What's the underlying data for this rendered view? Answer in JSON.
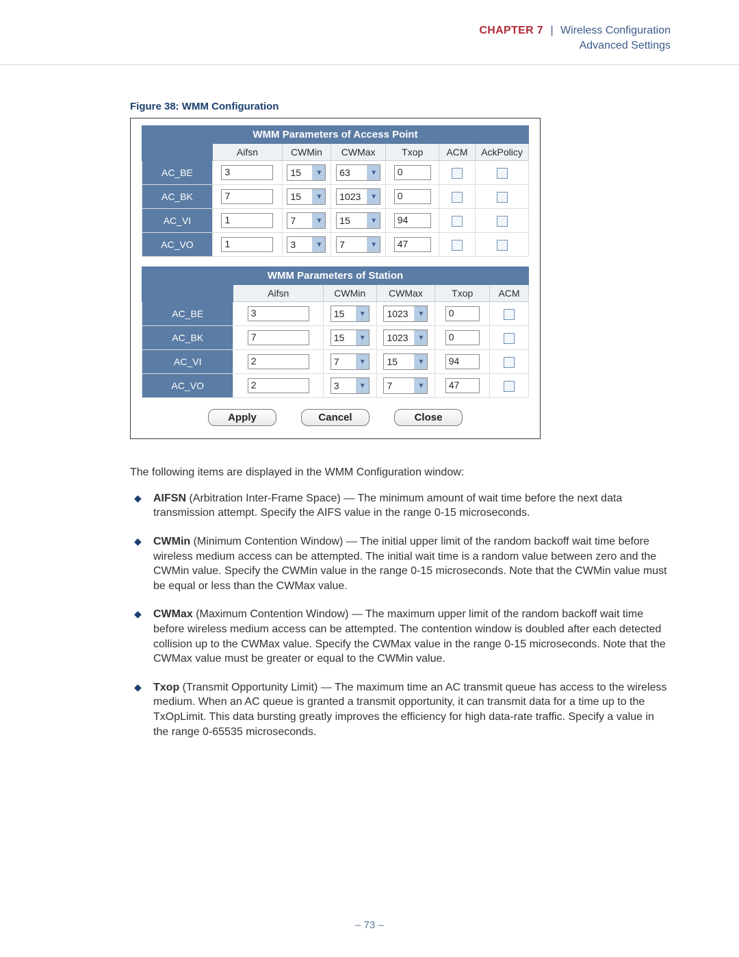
{
  "header": {
    "chapter_label": "CHAPTER 7",
    "pipe": "|",
    "title": "Wireless Configuration",
    "subtitle": "Advanced Settings"
  },
  "figure": {
    "caption": "Figure 38:  WMM Configuration",
    "ap": {
      "banner": "WMM Parameters of Access Point",
      "columns": [
        "",
        "Aifsn",
        "CWMin",
        "CWMax",
        "Txop",
        "ACM",
        "AckPolicy"
      ],
      "rows": [
        {
          "label": "AC_BE",
          "aifsn": "3",
          "cwmin": "15",
          "cwmax": "63",
          "txop": "0",
          "acm": false,
          "ack": false
        },
        {
          "label": "AC_BK",
          "aifsn": "7",
          "cwmin": "15",
          "cwmax": "1023",
          "txop": "0",
          "acm": false,
          "ack": false
        },
        {
          "label": "AC_VI",
          "aifsn": "1",
          "cwmin": "7",
          "cwmax": "15",
          "txop": "94",
          "acm": false,
          "ack": false
        },
        {
          "label": "AC_VO",
          "aifsn": "1",
          "cwmin": "3",
          "cwmax": "7",
          "txop": "47",
          "acm": false,
          "ack": false
        }
      ]
    },
    "sta": {
      "banner": "WMM Parameters of Station",
      "columns": [
        "",
        "Aifsn",
        "CWMin",
        "CWMax",
        "Txop",
        "ACM"
      ],
      "rows": [
        {
          "label": "AC_BE",
          "aifsn": "3",
          "cwmin": "15",
          "cwmax": "1023",
          "txop": "0",
          "acm": false
        },
        {
          "label": "AC_BK",
          "aifsn": "7",
          "cwmin": "15",
          "cwmax": "1023",
          "txop": "0",
          "acm": false
        },
        {
          "label": "AC_VI",
          "aifsn": "2",
          "cwmin": "7",
          "cwmax": "15",
          "txop": "94",
          "acm": false
        },
        {
          "label": "AC_VO",
          "aifsn": "2",
          "cwmin": "3",
          "cwmax": "7",
          "txop": "47",
          "acm": false
        }
      ]
    },
    "buttons": {
      "apply": "Apply",
      "cancel": "Cancel",
      "close": "Close"
    }
  },
  "body": {
    "intro": "The following items are displayed in the WMM Configuration window:",
    "items": [
      {
        "term": "AIFSN",
        "rest": " (Arbitration Inter-Frame Space) — The minimum amount of wait time before the next data transmission attempt. Specify the AIFS value in the range 0-15 microseconds."
      },
      {
        "term": "CWMin",
        "rest": " (Minimum Contention Window) — The initial upper limit of the random backoff wait time before wireless medium access can be attempted. The initial wait time is a random value between zero and the CWMin value. Specify the CWMin value in the range 0-15 microseconds. Note that the CWMin value must be equal or less than the CWMax value."
      },
      {
        "term": "CWMax",
        "rest": " (Maximum Contention Window) — The maximum upper limit of the random backoff wait time before wireless medium access can be attempted. The contention window is doubled after each detected collision up to the CWMax value. Specify the CWMax value in the range 0-15 microseconds. Note that the CWMax value must be greater or equal to the CWMin value."
      },
      {
        "term": "Txop",
        "rest": " (Transmit Opportunity Limit) — The maximum time an AC transmit queue has access to the wireless medium. When an AC queue is granted a transmit opportunity, it can transmit data for a time up to the TxOpLimit. This data bursting greatly improves the efficiency for high data-rate traffic. Specify a value in the range 0-65535 microseconds."
      }
    ]
  },
  "page_number": "–  73  –"
}
